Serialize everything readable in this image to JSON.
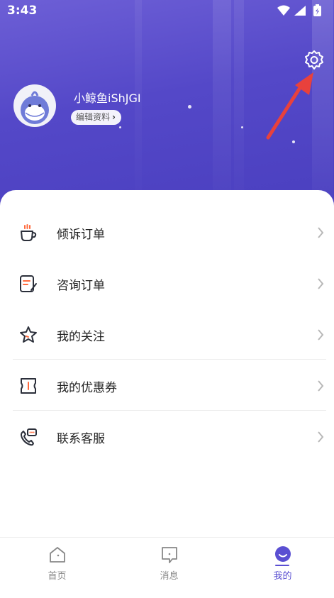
{
  "status_bar": {
    "time": "3:43"
  },
  "profile": {
    "username": "小鲸鱼iShJGI",
    "edit_label": "编辑资料"
  },
  "menu": [
    {
      "label": "倾诉订单",
      "icon": "cup-icon"
    },
    {
      "label": "咨询订单",
      "icon": "note-edit-icon"
    },
    {
      "label": "我的关注",
      "icon": "star-icon"
    },
    {
      "label": "我的优惠券",
      "icon": "coupon-icon"
    },
    {
      "label": "联系客服",
      "icon": "phone-chat-icon"
    }
  ],
  "tabbar": [
    {
      "label": "首页",
      "icon": "home-icon",
      "active": false
    },
    {
      "label": "消息",
      "icon": "message-icon",
      "active": false
    },
    {
      "label": "我的",
      "icon": "smile-icon",
      "active": true
    }
  ],
  "colors": {
    "accent": "#5a4fd2",
    "header": "#5448c8",
    "arrow": "#e8413c"
  }
}
